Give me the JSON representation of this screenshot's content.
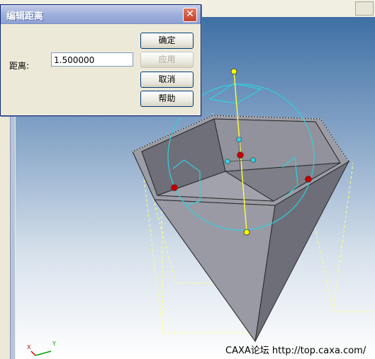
{
  "dialog": {
    "title": "编辑距离",
    "close_glyph": "✕",
    "distance_label": "距离:",
    "distance_value": "1.500000",
    "buttons": {
      "ok": "确定",
      "apply": "应用",
      "cancel": "取消",
      "help": "帮助"
    }
  },
  "watermark": "CAXA论坛 http://top.caxa.com/",
  "axis_labels": {
    "x": "X",
    "y": "Y"
  },
  "colors": {
    "viewport_top": "#3e6fa4",
    "solid_face": "#8e8e98",
    "handle_sphere": "#2fd0e0",
    "handle_axis": "#ffff40",
    "handle_point_red": "#c00000",
    "handle_point_yellow": "#ffff00",
    "guide_dashed": "#ffff80",
    "dialog_title": "#9fb0dc"
  }
}
